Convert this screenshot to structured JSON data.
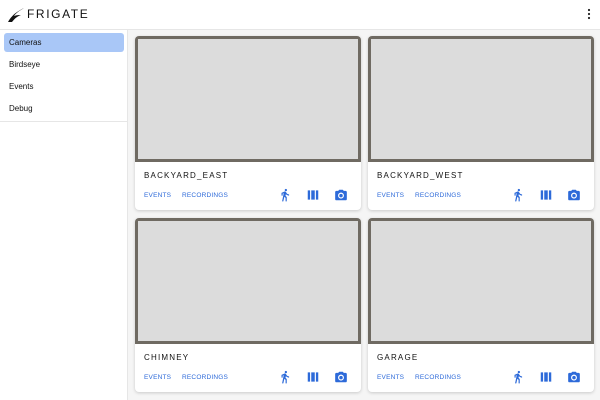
{
  "header": {
    "title": "FRIGATE"
  },
  "sidebar": {
    "items": [
      {
        "label": "Cameras"
      },
      {
        "label": "Birdseye"
      },
      {
        "label": "Events"
      },
      {
        "label": "Debug"
      }
    ]
  },
  "cameras": [
    {
      "name": "BACKYARD_EAST",
      "events_label": "EVENTS",
      "recordings_label": "RECORDINGS"
    },
    {
      "name": "BACKYARD_WEST",
      "events_label": "EVENTS",
      "recordings_label": "RECORDINGS"
    },
    {
      "name": "CHIMNEY",
      "events_label": "EVENTS",
      "recordings_label": "RECORDINGS"
    },
    {
      "name": "GARAGE",
      "events_label": "EVENTS",
      "recordings_label": "RECORDINGS"
    }
  ],
  "icons": {
    "logo": "frigate-bird-logo",
    "menu": "more-vertical-icon",
    "motion": "walking-person-icon",
    "recordings": "film-icon",
    "snapshot": "camera-icon"
  },
  "colors": {
    "accent": "#2d6ad9",
    "active_nav": "#a9c7f7",
    "thumbnail_placeholder": "#dcdcdc"
  }
}
